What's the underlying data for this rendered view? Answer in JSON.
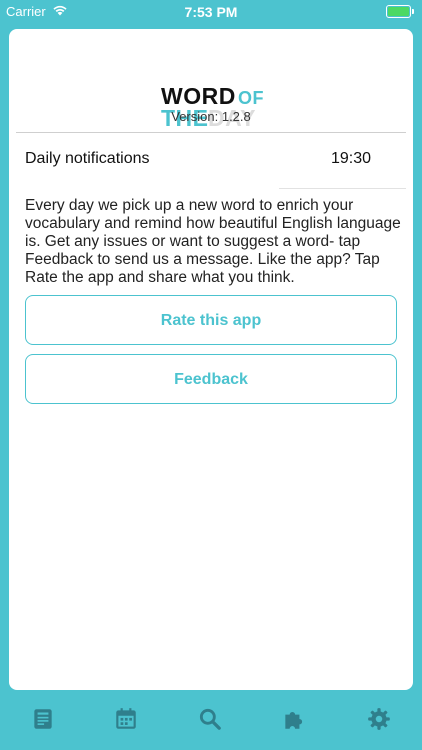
{
  "status_bar": {
    "carrier": "Carrier",
    "time": "7:53 PM"
  },
  "app": {
    "logo_word": "WORD",
    "logo_of": "OF",
    "logo_the": "THE",
    "logo_day": "DAY",
    "version": "Version: 1.2.8"
  },
  "settings": {
    "notifications_label": "Daily notifications",
    "notifications_time": "19:30",
    "description": "Every day we pick up a new word to enrich your vocabulary and remind how  beautiful English language is. Get any issues or want to suggest a word- tap Feedback to send us a message. Like the app? Tap Rate the app and share what you think.",
    "rate_button": "Rate this app",
    "feedback_button": "Feedback"
  },
  "tab_bar": {
    "items": [
      {
        "icon": "word-card-icon"
      },
      {
        "icon": "calendar-icon"
      },
      {
        "icon": "search-icon"
      },
      {
        "icon": "puzzle-icon"
      },
      {
        "icon": "gear-icon"
      }
    ]
  },
  "colors": {
    "accent": "#4cc3cf",
    "tab_icon": "#2f7f8c",
    "battery": "#4cd964"
  }
}
